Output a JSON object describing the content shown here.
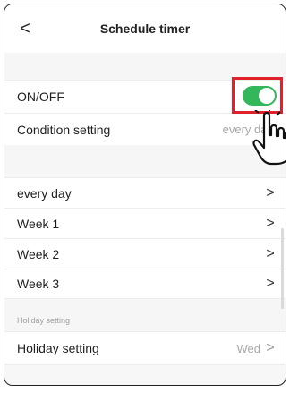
{
  "header": {
    "title": "Schedule timer",
    "back_icon": "chevron-left-icon"
  },
  "power": {
    "label": "ON/OFF",
    "toggle_on": true,
    "toggle_color": "#34b65a"
  },
  "condition": {
    "label": "Condition setting",
    "value": "every day"
  },
  "schedules": [
    {
      "label": "every day"
    },
    {
      "label": "Week 1"
    },
    {
      "label": "Week 2"
    },
    {
      "label": "Week 3"
    }
  ],
  "holiday": {
    "section_label": "Holiday setting",
    "label": "Holiday setting",
    "value": "Wed"
  },
  "annotation": {
    "highlight_color": "#e0202a",
    "pointer_icon": "hand-pointer-icon"
  }
}
